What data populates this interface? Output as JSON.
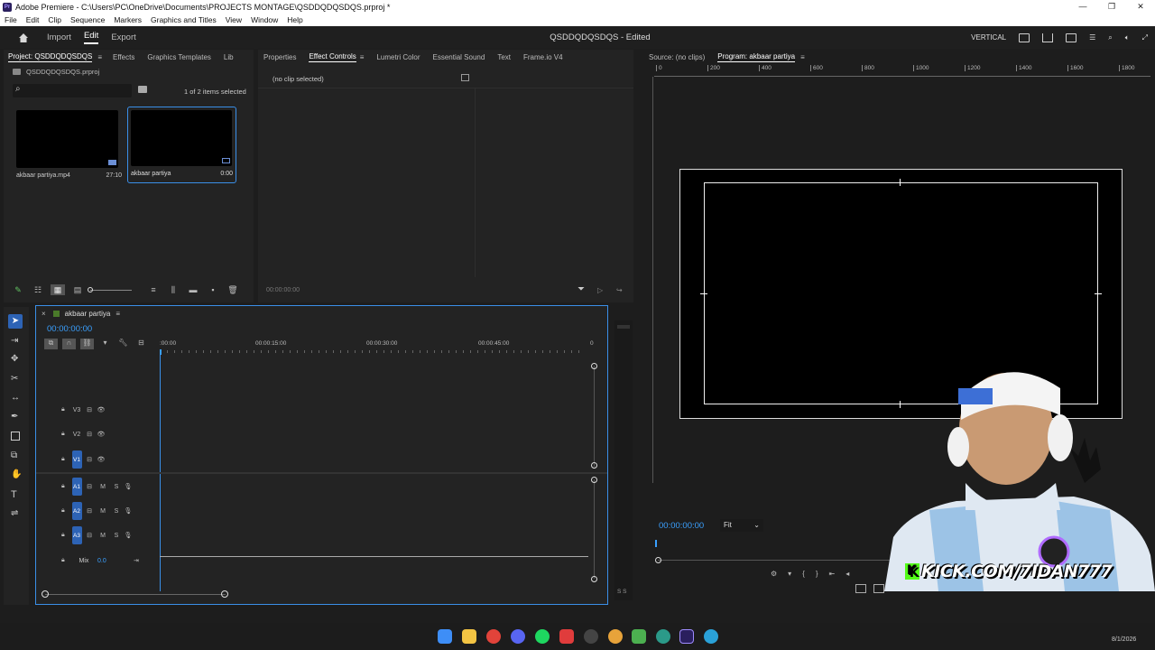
{
  "titlebar": {
    "title": "Adobe Premiere - C:\\Users\\PC\\OneDrive\\Documents\\PROJECTS MONTAGE\\QSDDQDQSDQS.prproj *",
    "app_icon": "Pr"
  },
  "menubar": {
    "items": [
      "File",
      "Edit",
      "Clip",
      "Sequence",
      "Markers",
      "Graphics and Titles",
      "View",
      "Window",
      "Help"
    ]
  },
  "header": {
    "tabs": [
      "Import",
      "Edit",
      "Export"
    ],
    "active_tab": "Edit",
    "project_title": "QSDDQDQSDQS - Edited",
    "workspace": "VERTICAL"
  },
  "project_panel": {
    "tabs": [
      "Project: QSDDQDQSDQS",
      "Effects",
      "Graphics Templates",
      "Lib"
    ],
    "file_name": "QSDDQDQSDQS.prproj",
    "selection_status": "1 of 2 items selected",
    "items": [
      {
        "name": "akbaar partiya.mp4",
        "duration": "27:10"
      },
      {
        "name": "akbaar partiya",
        "duration": "0:00"
      }
    ]
  },
  "effect_panel": {
    "tabs": [
      "Properties",
      "Effect Controls",
      "Lumetri Color",
      "Essential Sound",
      "Text",
      "Frame.io V4"
    ],
    "active_tab": "Effect Controls",
    "no_clip_text": "(no clip selected)",
    "timecode": "00:00:00:00"
  },
  "monitor": {
    "tabs": [
      "Source: (no clips)",
      "Program: akbaar partiya"
    ],
    "active_tab": "Program: akbaar partiya",
    "ruler_labels": [
      "0",
      "200",
      "400",
      "600",
      "800",
      "1000",
      "1200",
      "1400",
      "1600",
      "1800"
    ],
    "timecode": "00:00:00:00",
    "fit": "Fit"
  },
  "timeline": {
    "sequence_name": "akbaar partiya",
    "timecode": "00:00:00:00",
    "ruler_labels": [
      ":00:00",
      "00:00:15:00",
      "00:00:30:00",
      "00:00:45:00",
      "0"
    ],
    "video_tracks": [
      "V3",
      "V2",
      "V1"
    ],
    "audio_tracks": [
      "A1",
      "A2",
      "A3"
    ],
    "mix_label": "Mix",
    "mix_value": "0.0",
    "m_label": "M",
    "s_label": "S",
    "meter_label": "S S"
  },
  "overlay": {
    "stream_text": "KICK.COM/7IDAN777",
    "date": "8/1/2026"
  },
  "colors": {
    "accent": "#2d8ceb",
    "track_badge": "#2d63b5",
    "timecode": "#3aa0ff"
  }
}
